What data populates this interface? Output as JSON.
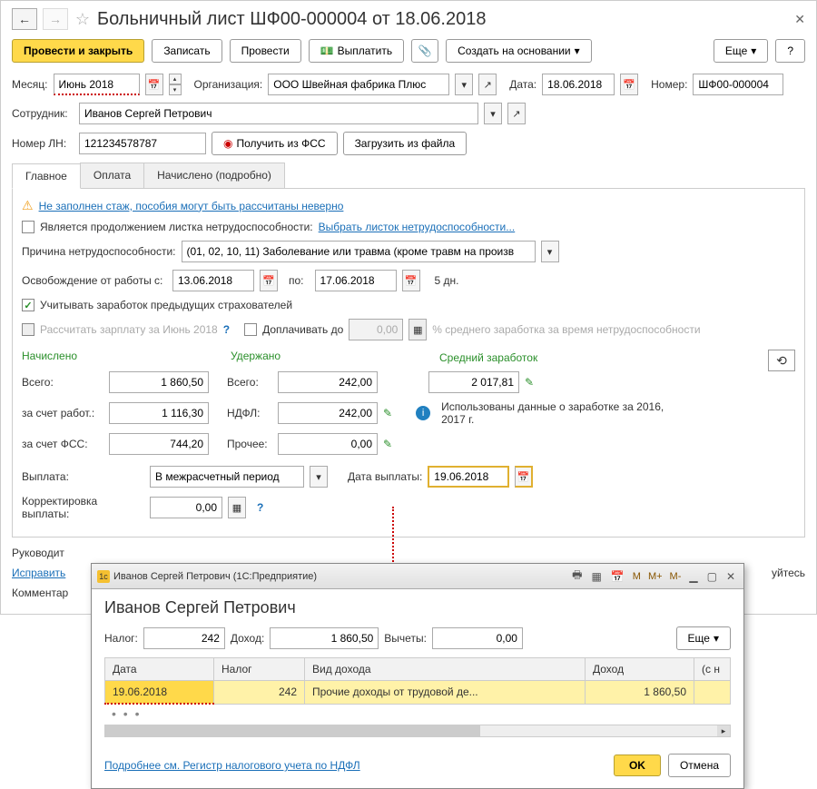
{
  "window_title": "Больничный лист ШФ00-000004 от 18.06.2018",
  "toolbar": {
    "post_close": "Провести и закрыть",
    "save": "Записать",
    "post": "Провести",
    "pay": "Выплатить",
    "create_based": "Создать на основании",
    "more": "Еще",
    "help": "?"
  },
  "fields": {
    "month_label": "Месяц:",
    "month": "Июнь 2018",
    "org_label": "Организация:",
    "org": "ООО Швейная фабрика Плюс",
    "date_label": "Дата:",
    "date": "18.06.2018",
    "number_label": "Номер:",
    "number": "ШФ00-000004",
    "employee_label": "Сотрудник:",
    "employee": "Иванов Сергей Петрович",
    "ln_label": "Номер ЛН:",
    "ln": "121234578787",
    "get_fss": "Получить из ФСС",
    "load_file": "Загрузить из файла"
  },
  "tabs": {
    "main": "Главное",
    "payment": "Оплата",
    "accrued": "Начислено (подробно)"
  },
  "main_tab": {
    "warning": "Не заполнен стаж, пособия могут быть рассчитаны неверно",
    "is_continuation": "Является продолжением листка нетрудоспособности:",
    "select_sheet": "Выбрать листок нетрудоспособности...",
    "reason_label": "Причина нетрудоспособности:",
    "reason": "(01, 02, 10, 11) Заболевание или травма (кроме травм на произв",
    "release_from": "Освобождение от работы с:",
    "date_from": "13.06.2018",
    "to": "по:",
    "date_to": "17.06.2018",
    "days": "5 дн.",
    "consider_prev": "Учитывать заработок предыдущих страхователей",
    "calc_salary": "Рассчитать зарплату за Июнь 2018",
    "extra_pay": "Доплачивать до",
    "extra_pay_val": "0,00",
    "extra_pay_hint": "% среднего заработка за время нетрудоспособности",
    "accrued_hdr": "Начислено",
    "withheld_hdr": "Удержано",
    "avg_hdr": "Средний заработок",
    "total_label": "Всего:",
    "total_accrued": "1 860,50",
    "total_withheld": "242,00",
    "avg_salary": "2 017,81",
    "employer_label": "за счет работ.:",
    "employer_amt": "1 116,30",
    "ndfl_label": "НДФЛ:",
    "ndfl_amt": "242,00",
    "avg_note": "Использованы данные о заработке за 2016,  2017 г.",
    "fss_label": "за счет ФСС:",
    "fss_amt": "744,20",
    "other_label": "Прочее:",
    "other_amt": "0,00",
    "payment_label": "Выплата:",
    "payment_type": "В межрасчетный период",
    "payment_date_label": "Дата выплаты:",
    "payment_date": "19.06.2018",
    "correction_label": "Корректировка выплаты:",
    "correction_amt": "0,00"
  },
  "footer": {
    "manager_label": "Руководит",
    "edit_link": "Исправить",
    "comment_label": "Комментар",
    "share_hint": "уйтесь"
  },
  "popup": {
    "titlebar": "Иванов Сергей Петрович  (1С:Предприятие)",
    "heading": "Иванов Сергей Петрович",
    "tax_label": "Налог:",
    "tax": "242",
    "income_label": "Доход:",
    "income": "1 860,50",
    "deductions_label": "Вычеты:",
    "deductions": "0,00",
    "more": "Еще",
    "cols": {
      "date": "Дата",
      "tax": "Налог",
      "income_type": "Вид дохода",
      "income": "Доход",
      "from": "(с н"
    },
    "row": {
      "date": "19.06.2018",
      "tax": "242",
      "income_type": "Прочие доходы от трудовой де...",
      "income": "1 860,50"
    },
    "more_link": "Подробнее см. Регистр налогового учета по НДФЛ",
    "ok": "OK",
    "cancel": "Отмена"
  }
}
